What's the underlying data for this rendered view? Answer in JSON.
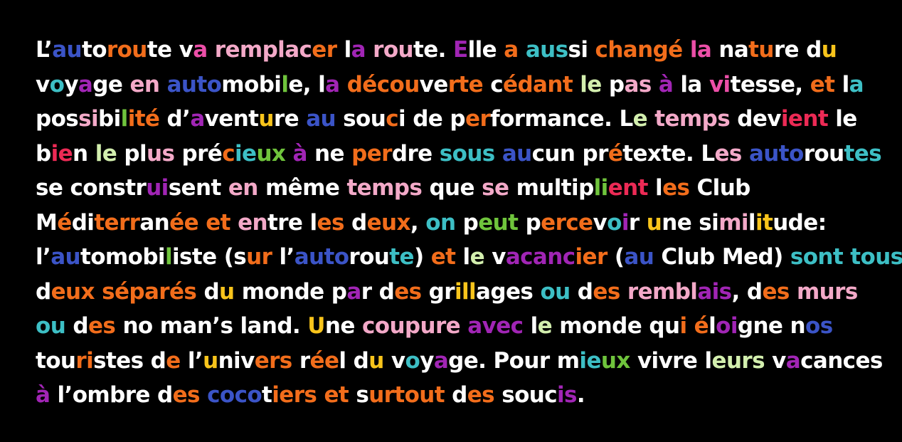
{
  "palette": {
    "w": "#ffffff",
    "b": "#3b54c7",
    "o": "#f26d1b",
    "p": "#ec4fa8",
    "v": "#a125b5",
    "g": "#6fc43c",
    "y": "#f8c41b",
    "t": "#3dbfc5",
    "k": "#f3a9c8",
    "l": "#d3efae",
    "r": "#ec2a55"
  },
  "lines": [
    {
      "text": "L’autoroute va remplacer la route. Elle a aussi changé la nature du",
      "segments": [
        {
          "t": "L’",
          "c": "w"
        },
        {
          "t": "au",
          "c": "b"
        },
        {
          "t": "to",
          "c": "w"
        },
        {
          "t": "rou",
          "c": "o"
        },
        {
          "t": "te v",
          "c": "w"
        },
        {
          "t": "a",
          "c": "p"
        },
        {
          "t": " ",
          "c": "w"
        },
        {
          "t": "remplac",
          "c": "k"
        },
        {
          "t": "er",
          "c": "o"
        },
        {
          "t": " l",
          "c": "w"
        },
        {
          "t": "a",
          "c": "v"
        },
        {
          "t": " ",
          "c": "w"
        },
        {
          "t": "rou",
          "c": "k"
        },
        {
          "t": "te. ",
          "c": "w"
        },
        {
          "t": "E",
          "c": "v"
        },
        {
          "t": "lle ",
          "c": "w"
        },
        {
          "t": "a",
          "c": "o"
        },
        {
          "t": " ",
          "c": "w"
        },
        {
          "t": "aus",
          "c": "t"
        },
        {
          "t": "si ",
          "c": "w"
        },
        {
          "t": "changé",
          "c": "o"
        },
        {
          "t": " ",
          "c": "w"
        },
        {
          "t": "la",
          "c": "p"
        },
        {
          "t": " na",
          "c": "w"
        },
        {
          "t": "tu",
          "c": "o"
        },
        {
          "t": "re d",
          "c": "w"
        },
        {
          "t": "u",
          "c": "y"
        }
      ]
    },
    {
      "text": "voyage en automobile, la découverte cédant le pas à la vitesse, et la",
      "segments": [
        {
          "t": "v",
          "c": "w"
        },
        {
          "t": "o",
          "c": "t"
        },
        {
          "t": "y",
          "c": "w"
        },
        {
          "t": "a",
          "c": "v"
        },
        {
          "t": "ge ",
          "c": "w"
        },
        {
          "t": "en",
          "c": "k"
        },
        {
          "t": " ",
          "c": "w"
        },
        {
          "t": "auto",
          "c": "b"
        },
        {
          "t": "mobi",
          "c": "w"
        },
        {
          "t": "l",
          "c": "g"
        },
        {
          "t": "e, l",
          "c": "w"
        },
        {
          "t": "a",
          "c": "v"
        },
        {
          "t": " ",
          "c": "w"
        },
        {
          "t": "décou",
          "c": "o"
        },
        {
          "t": "ve",
          "c": "w"
        },
        {
          "t": "rte",
          "c": "o"
        },
        {
          "t": " c",
          "c": "w"
        },
        {
          "t": "édant",
          "c": "o"
        },
        {
          "t": " ",
          "c": "w"
        },
        {
          "t": "le",
          "c": "l"
        },
        {
          "t": " p",
          "c": "w"
        },
        {
          "t": "as",
          "c": "k"
        },
        {
          "t": " ",
          "c": "w"
        },
        {
          "t": "à",
          "c": "v"
        },
        {
          "t": " la ",
          "c": "w"
        },
        {
          "t": "vi",
          "c": "p"
        },
        {
          "t": "tesse, ",
          "c": "w"
        },
        {
          "t": "et",
          "c": "o"
        },
        {
          "t": " l",
          "c": "w"
        },
        {
          "t": "a",
          "c": "t"
        }
      ]
    },
    {
      "text": "possibilité d’aventure au souci de performance. Le temps devient le",
      "segments": [
        {
          "t": "pos",
          "c": "w"
        },
        {
          "t": "si",
          "c": "k"
        },
        {
          "t": "bi",
          "c": "w"
        },
        {
          "t": "l",
          "c": "g"
        },
        {
          "t": "ité",
          "c": "o"
        },
        {
          "t": " d’",
          "c": "w"
        },
        {
          "t": "a",
          "c": "v"
        },
        {
          "t": "vent",
          "c": "w"
        },
        {
          "t": "u",
          "c": "y"
        },
        {
          "t": "re ",
          "c": "w"
        },
        {
          "t": "au",
          "c": "b"
        },
        {
          "t": " sou",
          "c": "w"
        },
        {
          "t": "c",
          "c": "o"
        },
        {
          "t": "i de p",
          "c": "w"
        },
        {
          "t": "er",
          "c": "o"
        },
        {
          "t": "formance. L",
          "c": "w"
        },
        {
          "t": "e",
          "c": "l"
        },
        {
          "t": " ",
          "c": "w"
        },
        {
          "t": "temps",
          "c": "k"
        },
        {
          "t": " dev",
          "c": "w"
        },
        {
          "t": "ient",
          "c": "r"
        },
        {
          "t": " le",
          "c": "w"
        }
      ]
    },
    {
      "text": "bien le plus précieux à ne perdre sous aucun prétexte. Les autoroutes",
      "segments": [
        {
          "t": "b",
          "c": "w"
        },
        {
          "t": "ie",
          "c": "r"
        },
        {
          "t": "n ",
          "c": "w"
        },
        {
          "t": "le",
          "c": "l"
        },
        {
          "t": " pl",
          "c": "w"
        },
        {
          "t": "us",
          "c": "k"
        },
        {
          "t": " pré",
          "c": "w"
        },
        {
          "t": "c",
          "c": "o"
        },
        {
          "t": "ie",
          "c": "t"
        },
        {
          "t": "ux",
          "c": "g"
        },
        {
          "t": " ",
          "c": "w"
        },
        {
          "t": "à",
          "c": "v"
        },
        {
          "t": " ne ",
          "c": "w"
        },
        {
          "t": "per",
          "c": "o"
        },
        {
          "t": "dre ",
          "c": "w"
        },
        {
          "t": "sous",
          "c": "t"
        },
        {
          "t": " ",
          "c": "w"
        },
        {
          "t": "au",
          "c": "b"
        },
        {
          "t": "cun pr",
          "c": "w"
        },
        {
          "t": "é",
          "c": "o"
        },
        {
          "t": "texte. L",
          "c": "w"
        },
        {
          "t": "es",
          "c": "k"
        },
        {
          "t": " ",
          "c": "w"
        },
        {
          "t": "auto",
          "c": "b"
        },
        {
          "t": "rou",
          "c": "w"
        },
        {
          "t": "tes",
          "c": "t"
        }
      ]
    },
    {
      "text": "se construisent en même temps que se multiplient les Club",
      "segments": [
        {
          "t": "se ",
          "c": "w"
        },
        {
          "t": "cons",
          "c": "w"
        },
        {
          "t": "tr",
          "c": "w"
        },
        {
          "t": "ui",
          "c": "v"
        },
        {
          "t": "sent ",
          "c": "w"
        },
        {
          "t": "en",
          "c": "k"
        },
        {
          "t": " ",
          "c": "w"
        },
        {
          "t": "même",
          "c": "w"
        },
        {
          "t": " ",
          "c": "w"
        },
        {
          "t": "temps",
          "c": "k"
        },
        {
          "t": " que ",
          "c": "w"
        },
        {
          "t": "se",
          "c": "k"
        },
        {
          "t": " mu",
          "c": "w"
        },
        {
          "t": "lti",
          "c": "w"
        },
        {
          "t": "p",
          "c": "w"
        },
        {
          "t": "li",
          "c": "g"
        },
        {
          "t": "ent",
          "c": "r"
        },
        {
          "t": " l",
          "c": "w"
        },
        {
          "t": "es",
          "c": "o"
        },
        {
          "t": " Club",
          "c": "w"
        }
      ]
    },
    {
      "text": "Méditerranée et entre les deux, on peut percevoir une similitude:",
      "segments": [
        {
          "t": "M",
          "c": "w"
        },
        {
          "t": "é",
          "c": "o"
        },
        {
          "t": "di",
          "c": "w"
        },
        {
          "t": "terr",
          "c": "o"
        },
        {
          "t": "an",
          "c": "w"
        },
        {
          "t": "ée",
          "c": "o"
        },
        {
          "t": " ",
          "c": "w"
        },
        {
          "t": "et",
          "c": "o"
        },
        {
          "t": " ",
          "c": "w"
        },
        {
          "t": "en",
          "c": "k"
        },
        {
          "t": "tre l",
          "c": "w"
        },
        {
          "t": "es",
          "c": "o"
        },
        {
          "t": " d",
          "c": "w"
        },
        {
          "t": "eux",
          "c": "o"
        },
        {
          "t": ", ",
          "c": "w"
        },
        {
          "t": "on",
          "c": "t"
        },
        {
          "t": " p",
          "c": "w"
        },
        {
          "t": "eut",
          "c": "g"
        },
        {
          "t": " p",
          "c": "w"
        },
        {
          "t": "erce",
          "c": "o"
        },
        {
          "t": "v",
          "c": "w"
        },
        {
          "t": "o",
          "c": "t"
        },
        {
          "t": "i",
          "c": "v"
        },
        {
          "t": "r ",
          "c": "w"
        },
        {
          "t": "u",
          "c": "y"
        },
        {
          "t": "ne si",
          "c": "w"
        },
        {
          "t": "mi",
          "c": "k"
        },
        {
          "t": "l",
          "c": "w"
        },
        {
          "t": "it",
          "c": "y"
        },
        {
          "t": "ude:",
          "c": "w"
        }
      ]
    },
    {
      "text": "l’automobiliste (sur l’autoroute) et le vacancier (au Club Med) sont tous",
      "segments": [
        {
          "t": "l’",
          "c": "w"
        },
        {
          "t": "au",
          "c": "b"
        },
        {
          "t": "to",
          "c": "w"
        },
        {
          "t": "mo",
          "c": "w"
        },
        {
          "t": "bi",
          "c": "w"
        },
        {
          "t": "l",
          "c": "g"
        },
        {
          "t": "iste (s",
          "c": "w"
        },
        {
          "t": "ur",
          "c": "o"
        },
        {
          "t": " l’",
          "c": "w"
        },
        {
          "t": "auto",
          "c": "b"
        },
        {
          "t": "rou",
          "c": "w"
        },
        {
          "t": "te",
          "c": "t"
        },
        {
          "t": ") ",
          "c": "w"
        },
        {
          "t": "et",
          "c": "o"
        },
        {
          "t": " l",
          "c": "w"
        },
        {
          "t": "e",
          "c": "l"
        },
        {
          "t": " v",
          "c": "w"
        },
        {
          "t": "acanc",
          "c": "v"
        },
        {
          "t": "ier",
          "c": "o"
        },
        {
          "t": " (",
          "c": "w"
        },
        {
          "t": "au",
          "c": "b"
        },
        {
          "t": " Club Med) ",
          "c": "w"
        },
        {
          "t": "sont tous",
          "c": "t"
        }
      ]
    },
    {
      "text": "deux séparés du monde par des grillages ou des remblais, des murs",
      "segments": [
        {
          "t": "d",
          "c": "w"
        },
        {
          "t": "eux",
          "c": "o"
        },
        {
          "t": " ",
          "c": "w"
        },
        {
          "t": "séparés",
          "c": "o"
        },
        {
          "t": " d",
          "c": "w"
        },
        {
          "t": "u",
          "c": "y"
        },
        {
          "t": " monde p",
          "c": "w"
        },
        {
          "t": "a",
          "c": "v"
        },
        {
          "t": "r d",
          "c": "w"
        },
        {
          "t": "es",
          "c": "o"
        },
        {
          "t": " gr",
          "c": "w"
        },
        {
          "t": "ill",
          "c": "y"
        },
        {
          "t": "ages ",
          "c": "w"
        },
        {
          "t": "ou",
          "c": "t"
        },
        {
          "t": " d",
          "c": "w"
        },
        {
          "t": "es",
          "c": "o"
        },
        {
          "t": " ",
          "c": "w"
        },
        {
          "t": "rembl",
          "c": "k"
        },
        {
          "t": "ais",
          "c": "v"
        },
        {
          "t": ", d",
          "c": "w"
        },
        {
          "t": "es",
          "c": "o"
        },
        {
          "t": " ",
          "c": "w"
        },
        {
          "t": "murs",
          "c": "k"
        }
      ]
    },
    {
      "text": "ou des no man’s land. Une coupure avec le monde qui éloigne nos",
      "segments": [
        {
          "t": "ou",
          "c": "t"
        },
        {
          "t": " d",
          "c": "w"
        },
        {
          "t": "es",
          "c": "o"
        },
        {
          "t": " no man’s land. ",
          "c": "w"
        },
        {
          "t": "U",
          "c": "y"
        },
        {
          "t": "ne ",
          "c": "w"
        },
        {
          "t": "coupure",
          "c": "k"
        },
        {
          "t": " ",
          "c": "w"
        },
        {
          "t": "avec",
          "c": "v"
        },
        {
          "t": " l",
          "c": "w"
        },
        {
          "t": "e",
          "c": "l"
        },
        {
          "t": " monde qu",
          "c": "w"
        },
        {
          "t": "i",
          "c": "o"
        },
        {
          "t": " ",
          "c": "w"
        },
        {
          "t": "é",
          "c": "o"
        },
        {
          "t": "l",
          "c": "w"
        },
        {
          "t": "oi",
          "c": "v"
        },
        {
          "t": "gne n",
          "c": "w"
        },
        {
          "t": "os",
          "c": "b"
        }
      ]
    },
    {
      "text": "touristes de l’univers réel du voyage. Pour mieux vivre leurs vacances",
      "segments": [
        {
          "t": "tou",
          "c": "w"
        },
        {
          "t": "ri",
          "c": "o"
        },
        {
          "t": "stes d",
          "c": "w"
        },
        {
          "t": "e",
          "c": "o"
        },
        {
          "t": " l’",
          "c": "w"
        },
        {
          "t": "u",
          "c": "y"
        },
        {
          "t": "niv",
          "c": "w"
        },
        {
          "t": "ers",
          "c": "o"
        },
        {
          "t": " r",
          "c": "w"
        },
        {
          "t": "ée",
          "c": "o"
        },
        {
          "t": "l d",
          "c": "w"
        },
        {
          "t": "u",
          "c": "y"
        },
        {
          "t": " v",
          "c": "w"
        },
        {
          "t": "o",
          "c": "t"
        },
        {
          "t": "y",
          "c": "w"
        },
        {
          "t": "a",
          "c": "v"
        },
        {
          "t": "ge. Pour m",
          "c": "w"
        },
        {
          "t": "ie",
          "c": "t"
        },
        {
          "t": "ux",
          "c": "g"
        },
        {
          "t": " vi",
          "c": "w"
        },
        {
          "t": "vre",
          "c": "w"
        },
        {
          "t": " l",
          "c": "w"
        },
        {
          "t": "eurs",
          "c": "l"
        },
        {
          "t": " v",
          "c": "w"
        },
        {
          "t": "a",
          "c": "v"
        },
        {
          "t": "cances",
          "c": "w"
        }
      ]
    },
    {
      "text": "à l’ombre des cocotiers et surtout des soucis.",
      "segments": [
        {
          "t": "à",
          "c": "v"
        },
        {
          "t": " l’ombre d",
          "c": "w"
        },
        {
          "t": "es",
          "c": "o"
        },
        {
          "t": " ",
          "c": "w"
        },
        {
          "t": "coco",
          "c": "b"
        },
        {
          "t": "t",
          "c": "w"
        },
        {
          "t": "iers",
          "c": "o"
        },
        {
          "t": " ",
          "c": "w"
        },
        {
          "t": "et",
          "c": "o"
        },
        {
          "t": " s",
          "c": "w"
        },
        {
          "t": "urtout",
          "c": "o"
        },
        {
          "t": " d",
          "c": "w"
        },
        {
          "t": "es",
          "c": "o"
        },
        {
          "t": " souc",
          "c": "w"
        },
        {
          "t": "is",
          "c": "v"
        },
        {
          "t": ".",
          "c": "w"
        }
      ]
    }
  ]
}
